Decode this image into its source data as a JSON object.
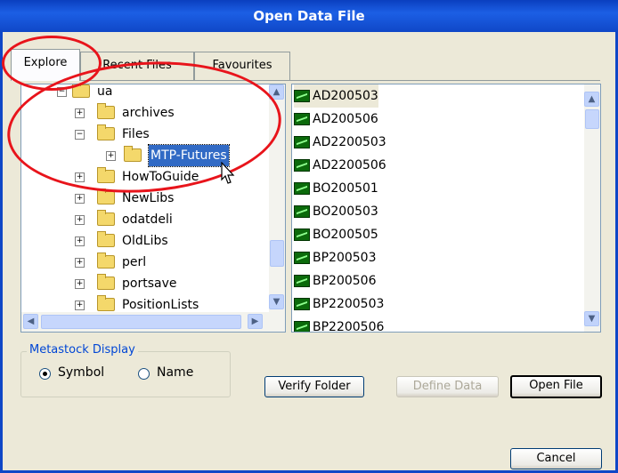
{
  "window": {
    "title": "Open Data File"
  },
  "tabs": [
    {
      "label": "Explore",
      "active": true
    },
    {
      "label": "Recent Files",
      "active": false
    },
    {
      "label": "Favourites",
      "active": false
    }
  ],
  "tree": {
    "nodes": [
      {
        "label": "ua",
        "expander": "−"
      },
      {
        "label": "archives",
        "expander": "+"
      },
      {
        "label": "Files",
        "expander": "−"
      },
      {
        "label": "MTP-Futures",
        "expander": "+",
        "selected": true
      },
      {
        "label": "HowToGuide",
        "expander": "+"
      },
      {
        "label": "NewLibs",
        "expander": "+"
      },
      {
        "label": "odatdeli",
        "expander": "+"
      },
      {
        "label": "OldLibs",
        "expander": "+"
      },
      {
        "label": "perl",
        "expander": "+"
      },
      {
        "label": "portsave",
        "expander": "+"
      },
      {
        "label": "PositionLists",
        "expander": "+"
      }
    ]
  },
  "files": [
    "AD200503",
    "AD200506",
    "AD2200503",
    "AD2200506",
    "BO200501",
    "BO200503",
    "BO200505",
    "BP200503",
    "BP200506",
    "BP2200503",
    "BP2200506"
  ],
  "display": {
    "group_label": "Metastock Display",
    "options": [
      {
        "label": "Symbol",
        "checked": true
      },
      {
        "label": "Name",
        "checked": false
      }
    ]
  },
  "buttons": {
    "verify": "Verify Folder",
    "define": "Define Data",
    "open": "Open File",
    "cancel": "Cancel"
  },
  "icons": {
    "folder": "folder-icon",
    "file": "chart-file-icon"
  },
  "colors": {
    "title_bar": "#1c5fe5",
    "selection": "#316ac5",
    "annotation": "#e8141b"
  }
}
